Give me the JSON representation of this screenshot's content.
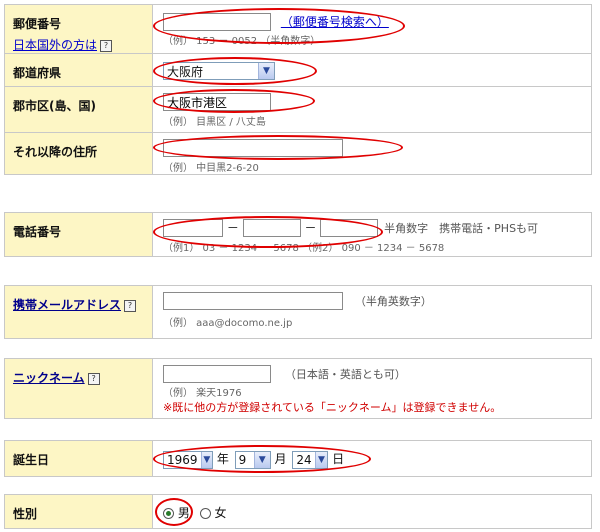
{
  "postal": {
    "label": "郵便番号",
    "overseas_link": "日本国外の方は",
    "overseas_help_icon": "?",
    "search_link": "（郵便番号検索へ）",
    "hint": "（例） 153 － 0052 （半角数字）"
  },
  "prefecture": {
    "label": "都道府県",
    "value": "大阪府"
  },
  "city": {
    "label": "郡市区(島、国)",
    "value": "大阪市港区",
    "hint": "（例） 目黒区 / 八丈島"
  },
  "address": {
    "label": "それ以降の住所",
    "hint": "（例） 中目黒2-6-20"
  },
  "phone": {
    "label": "電話番号",
    "separator": "－",
    "note": "半角数字　携帯電話・PHSも可",
    "hint": "（例1） 03 － 1234 － 5678 （例2） 090 － 1234 － 5678"
  },
  "mobile_email": {
    "label": "携帯メールアドレス",
    "help_icon": "?",
    "value": "",
    "note": "（半角英数字）",
    "hint": "（例） aaa@docomo.ne.jp"
  },
  "nickname": {
    "label": "ニックネーム",
    "help_icon": "?",
    "value": "",
    "note": "（日本語・英語とも可）",
    "hint": "（例） 楽天1976",
    "warning": "※既に他の方が登録されている「ニックネーム」は登録できません。"
  },
  "birthday": {
    "label": "誕生日",
    "year": "1969",
    "year_unit": "年",
    "month": "9",
    "month_unit": "月",
    "day": "24",
    "day_unit": "日"
  },
  "gender": {
    "label": "性別",
    "male": "男",
    "female": "女",
    "selected": "male"
  },
  "colors": {
    "label_bg": "#fdf6c5",
    "border": "#c8c8c8",
    "oval": "#e00000",
    "warning": "#d00000"
  }
}
